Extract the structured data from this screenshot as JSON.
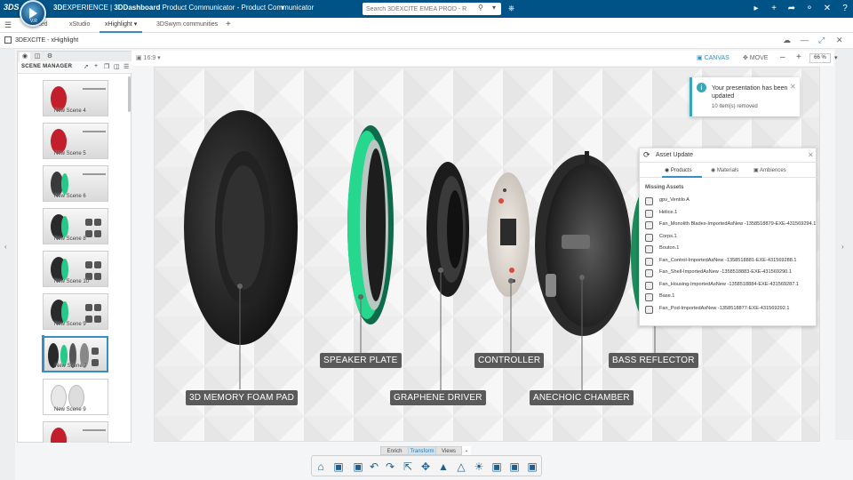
{
  "topbar": {
    "brand_label": "3DS",
    "compass_version": "V.R",
    "title_prefix": "3D",
    "title_rest": "EXPERIENCE | ",
    "dashboard": "3DDashboard",
    "app_name": " Product Communicator - Product Communicator",
    "search_placeholder": "Search 3DEXCITE EMEA PROD - R1132101",
    "icons": [
      "search-icon",
      "chevron-down-icon",
      "tag-icon",
      "flag-icon",
      "plus-icon",
      "share-icon",
      "network-icon",
      "tools-icon",
      "help-icon"
    ]
  },
  "tabs": [
    {
      "label": "...ted",
      "active": false
    },
    {
      "label": "xStudio",
      "active": false
    },
    {
      "label": "xHighlight",
      "active": true
    },
    {
      "label": "3DSwym communities",
      "active": false
    }
  ],
  "app_header": {
    "title": "3DEXCITE - xHighlight"
  },
  "scene_manager": {
    "title": "SCENE MANAGER",
    "scenes": [
      {
        "label": "New Scene 4",
        "kind": "red"
      },
      {
        "label": "New Scene 5",
        "kind": "red"
      },
      {
        "label": "New Scene 6",
        "kind": "open"
      },
      {
        "label": "New Scene 8",
        "kind": "green"
      },
      {
        "label": "New Scene 10",
        "kind": "green"
      },
      {
        "label": "New Scene 9",
        "kind": "green"
      },
      {
        "label": "New Scene 7",
        "kind": "exploded",
        "selected": true
      },
      {
        "label": "New Scene 9",
        "kind": "white"
      },
      {
        "label": "",
        "kind": "red"
      }
    ]
  },
  "canvas_header": {
    "ratio": "16:9",
    "canvas_label": "CANVAS",
    "move_label": "MOVE",
    "zoom": "66 %"
  },
  "callouts": {
    "foam": "3D MEMORY FOAM PAD",
    "speaker": "SPEAKER PLATE",
    "graphene": "GRAPHENE DRIVER",
    "controller": "CONTROLLER",
    "anechoic": "ANECHOIC CHAMBER",
    "bass": "BASS REFLECTOR"
  },
  "notification": {
    "title": "Your presentation has been updated",
    "subtitle": "10 item(s) removed"
  },
  "asset_update": {
    "title": "Asset Update",
    "tabs": [
      "Products",
      "Materials",
      "Ambiences"
    ],
    "missing_label": "Missing Assets",
    "items": [
      "gpv_Ventilo A",
      "Hélice.1",
      "Fan_Monolith Blades-ImportedAsNew -1358518879-EXE-431569294.1",
      "Corps.1",
      "Bouton.1",
      "Fan_Control-ImportedAsNew -1358518881-EXE-431569288.1",
      "Fan_Shell-ImportedAsNew -1358518883-EXE-431569290.1",
      "Fan_Housing-ImportedAsNew -1358518884-EXE-431569287.1",
      "Base.1",
      "Fan_Pod-ImportedAsNew -1358518877-EXE-431569292.1"
    ]
  },
  "mode_tabs": [
    {
      "label": "Enrich",
      "active": false
    },
    {
      "label": "Transform",
      "active": true
    },
    {
      "label": "Views",
      "active": false
    }
  ],
  "colors": {
    "accent": "#368ec4",
    "topbar": "#005386",
    "ring": "#27c98a",
    "info": "#3aa6b9"
  }
}
